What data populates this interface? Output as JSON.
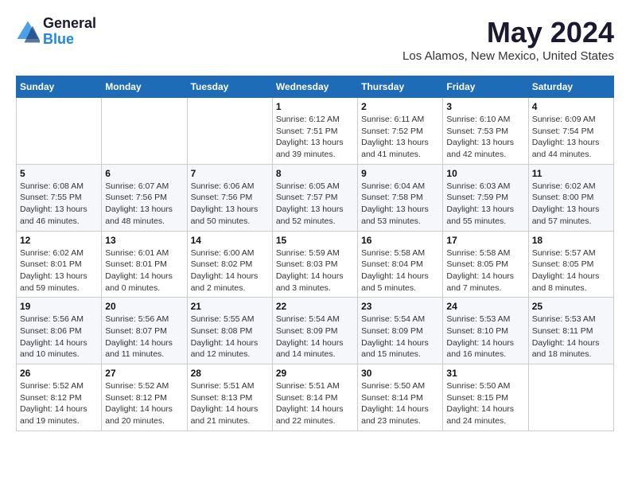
{
  "logo": {
    "general": "General",
    "blue": "Blue"
  },
  "title": "May 2024",
  "location": "Los Alamos, New Mexico, United States",
  "weekdays": [
    "Sunday",
    "Monday",
    "Tuesday",
    "Wednesday",
    "Thursday",
    "Friday",
    "Saturday"
  ],
  "weeks": [
    [
      null,
      null,
      null,
      {
        "day": "1",
        "sunrise": "6:12 AM",
        "sunset": "7:51 PM",
        "daylight": "13 hours and 39 minutes."
      },
      {
        "day": "2",
        "sunrise": "6:11 AM",
        "sunset": "7:52 PM",
        "daylight": "13 hours and 41 minutes."
      },
      {
        "day": "3",
        "sunrise": "6:10 AM",
        "sunset": "7:53 PM",
        "daylight": "13 hours and 42 minutes."
      },
      {
        "day": "4",
        "sunrise": "6:09 AM",
        "sunset": "7:54 PM",
        "daylight": "13 hours and 44 minutes."
      }
    ],
    [
      {
        "day": "5",
        "sunrise": "6:08 AM",
        "sunset": "7:55 PM",
        "daylight": "13 hours and 46 minutes."
      },
      {
        "day": "6",
        "sunrise": "6:07 AM",
        "sunset": "7:56 PM",
        "daylight": "13 hours and 48 minutes."
      },
      {
        "day": "7",
        "sunrise": "6:06 AM",
        "sunset": "7:56 PM",
        "daylight": "13 hours and 50 minutes."
      },
      {
        "day": "8",
        "sunrise": "6:05 AM",
        "sunset": "7:57 PM",
        "daylight": "13 hours and 52 minutes."
      },
      {
        "day": "9",
        "sunrise": "6:04 AM",
        "sunset": "7:58 PM",
        "daylight": "13 hours and 53 minutes."
      },
      {
        "day": "10",
        "sunrise": "6:03 AM",
        "sunset": "7:59 PM",
        "daylight": "13 hours and 55 minutes."
      },
      {
        "day": "11",
        "sunrise": "6:02 AM",
        "sunset": "8:00 PM",
        "daylight": "13 hours and 57 minutes."
      }
    ],
    [
      {
        "day": "12",
        "sunrise": "6:02 AM",
        "sunset": "8:01 PM",
        "daylight": "13 hours and 59 minutes."
      },
      {
        "day": "13",
        "sunrise": "6:01 AM",
        "sunset": "8:01 PM",
        "daylight": "14 hours and 0 minutes."
      },
      {
        "day": "14",
        "sunrise": "6:00 AM",
        "sunset": "8:02 PM",
        "daylight": "14 hours and 2 minutes."
      },
      {
        "day": "15",
        "sunrise": "5:59 AM",
        "sunset": "8:03 PM",
        "daylight": "14 hours and 3 minutes."
      },
      {
        "day": "16",
        "sunrise": "5:58 AM",
        "sunset": "8:04 PM",
        "daylight": "14 hours and 5 minutes."
      },
      {
        "day": "17",
        "sunrise": "5:58 AM",
        "sunset": "8:05 PM",
        "daylight": "14 hours and 7 minutes."
      },
      {
        "day": "18",
        "sunrise": "5:57 AM",
        "sunset": "8:05 PM",
        "daylight": "14 hours and 8 minutes."
      }
    ],
    [
      {
        "day": "19",
        "sunrise": "5:56 AM",
        "sunset": "8:06 PM",
        "daylight": "14 hours and 10 minutes."
      },
      {
        "day": "20",
        "sunrise": "5:56 AM",
        "sunset": "8:07 PM",
        "daylight": "14 hours and 11 minutes."
      },
      {
        "day": "21",
        "sunrise": "5:55 AM",
        "sunset": "8:08 PM",
        "daylight": "14 hours and 12 minutes."
      },
      {
        "day": "22",
        "sunrise": "5:54 AM",
        "sunset": "8:09 PM",
        "daylight": "14 hours and 14 minutes."
      },
      {
        "day": "23",
        "sunrise": "5:54 AM",
        "sunset": "8:09 PM",
        "daylight": "14 hours and 15 minutes."
      },
      {
        "day": "24",
        "sunrise": "5:53 AM",
        "sunset": "8:10 PM",
        "daylight": "14 hours and 16 minutes."
      },
      {
        "day": "25",
        "sunrise": "5:53 AM",
        "sunset": "8:11 PM",
        "daylight": "14 hours and 18 minutes."
      }
    ],
    [
      {
        "day": "26",
        "sunrise": "5:52 AM",
        "sunset": "8:12 PM",
        "daylight": "14 hours and 19 minutes."
      },
      {
        "day": "27",
        "sunrise": "5:52 AM",
        "sunset": "8:12 PM",
        "daylight": "14 hours and 20 minutes."
      },
      {
        "day": "28",
        "sunrise": "5:51 AM",
        "sunset": "8:13 PM",
        "daylight": "14 hours and 21 minutes."
      },
      {
        "day": "29",
        "sunrise": "5:51 AM",
        "sunset": "8:14 PM",
        "daylight": "14 hours and 22 minutes."
      },
      {
        "day": "30",
        "sunrise": "5:50 AM",
        "sunset": "8:14 PM",
        "daylight": "14 hours and 23 minutes."
      },
      {
        "day": "31",
        "sunrise": "5:50 AM",
        "sunset": "8:15 PM",
        "daylight": "14 hours and 24 minutes."
      },
      null
    ]
  ]
}
